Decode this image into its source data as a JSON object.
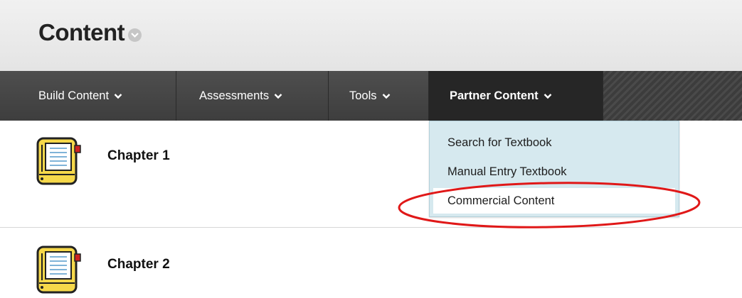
{
  "header": {
    "title": "Content"
  },
  "toolbar": {
    "buttons": [
      {
        "label": "Build Content"
      },
      {
        "label": "Assessments"
      },
      {
        "label": "Tools"
      },
      {
        "label": "Partner Content"
      }
    ]
  },
  "dropdown": {
    "items": [
      {
        "label": "Search for Textbook"
      },
      {
        "label": "Manual Entry Textbook"
      },
      {
        "label": "Commercial Content"
      }
    ]
  },
  "content": {
    "items": [
      {
        "title": "Chapter 1",
        "icon": "notebook-icon"
      },
      {
        "title": "Chapter 2",
        "icon": "notebook-icon"
      }
    ]
  },
  "colors": {
    "toolbar": "#3a3a3a",
    "active_tab": "#262626",
    "dropdown_bg": "#d6e9ef",
    "annotation": "#e01818",
    "notebook": "#f6d84a"
  }
}
